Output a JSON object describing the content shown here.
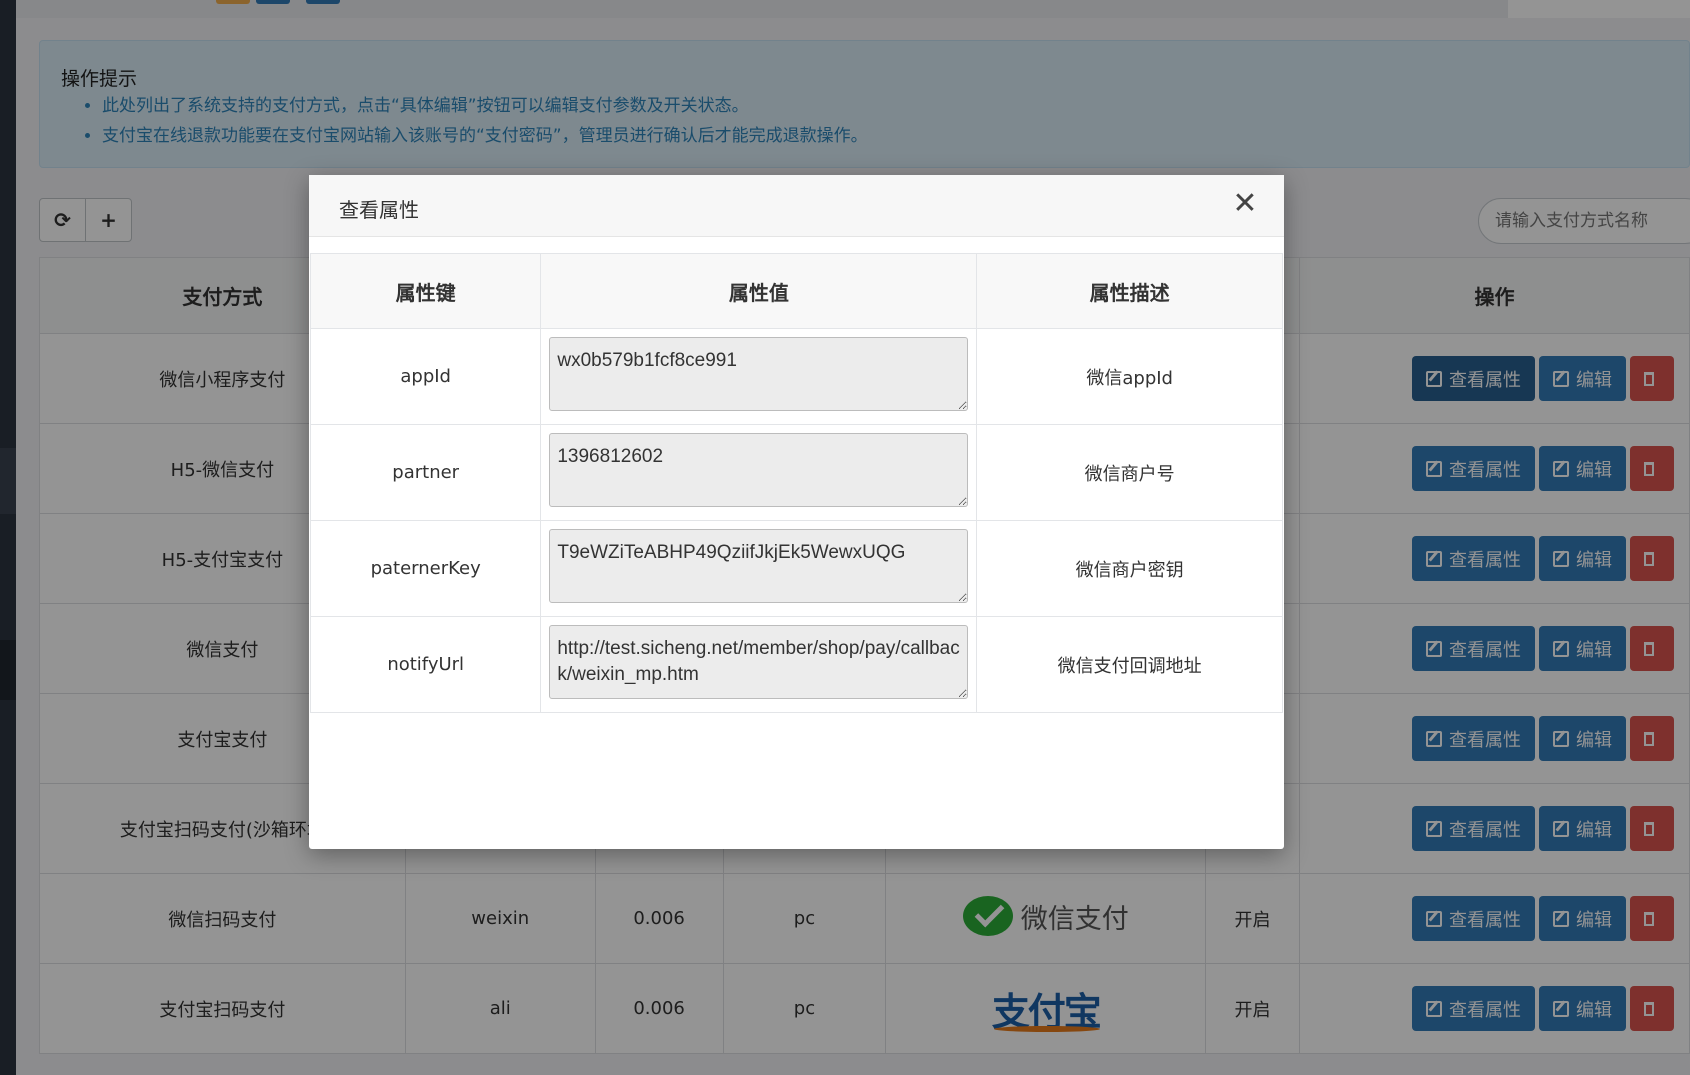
{
  "notice": {
    "title": "操作提示",
    "items": [
      "此处列出了系统支持的支付方式，点击“具体编辑”按钮可以编辑支付参数及开关状态。",
      "支付宝在线退款功能要在支付宝网站输入该账号的“支付密码”，管理员进行确认后才能完成退款操作。"
    ]
  },
  "toolbar": {
    "refresh_icon": "⟳",
    "add_icon": "+"
  },
  "search": {
    "placeholder": "请输入支付方式名称"
  },
  "table": {
    "headers": {
      "name": "支付方式",
      "ops": "操作"
    },
    "rows": [
      {
        "name": "微信小程序支付"
      },
      {
        "name": "H5-微信支付"
      },
      {
        "name": "H5-支付宝支付"
      },
      {
        "name": "微信支付"
      },
      {
        "name": "支付宝支付"
      },
      {
        "name": "支付宝扫码支付(沙箱环境"
      },
      {
        "name": "微信扫码支付",
        "code": "weixin",
        "rate": "0.006",
        "platform": "pc",
        "logo_text": "微信支付",
        "status": "开启"
      },
      {
        "name": "支付宝扫码支付",
        "code": "ali",
        "rate": "0.006",
        "platform": "pc",
        "logo_text": "支付宝",
        "status": "开启"
      }
    ],
    "buttons": {
      "view": "查看属性",
      "edit": "编辑"
    }
  },
  "modal": {
    "title": "查看属性",
    "close": "✕",
    "headers": {
      "key": "属性键",
      "value": "属性值",
      "desc": "属性描述"
    },
    "rows": [
      {
        "key": "appId",
        "value": "wx0b579b1fcf8ce991",
        "desc": "微信appId"
      },
      {
        "key": "partner",
        "value": "1396812602",
        "desc": "微信商户号"
      },
      {
        "key": "paternerKey",
        "value": "T9eWZiTeABHP49QziifJkjEk5WewxUQG",
        "desc": "微信商户密钥"
      },
      {
        "key": "notifyUrl",
        "value": "http://test.sicheng.net/member/shop/pay/callback/weixin_mp.htm",
        "desc": "微信支付回调地址"
      }
    ]
  },
  "colors": {
    "primary": "#337ab7",
    "primary_active": "#286090",
    "danger": "#d9534f",
    "wechat": "#2bad38",
    "alipay": "#1d5fa8"
  }
}
